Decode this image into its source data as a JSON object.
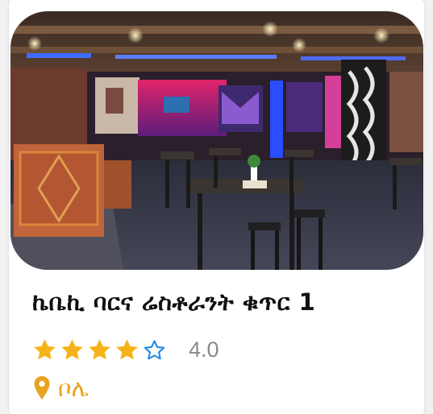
{
  "listing": {
    "name": "ኬቤኪ ባርና ሬስቶራንት ቁጥር 1",
    "rating": 4,
    "rating_text": "4.0",
    "max_rating": 5,
    "location": "ቦሌ"
  },
  "photo": {
    "subject": "bar-interior-photo"
  },
  "icons": {
    "star_filled": "star-icon",
    "star_empty": "star-outline-icon",
    "location": "location-pin-icon"
  },
  "colors": {
    "star_filled": "#f6b319",
    "star_empty": "#1e88e5",
    "location": "#e9a323",
    "rating_text": "#8a8a8a",
    "title": "#111111"
  }
}
